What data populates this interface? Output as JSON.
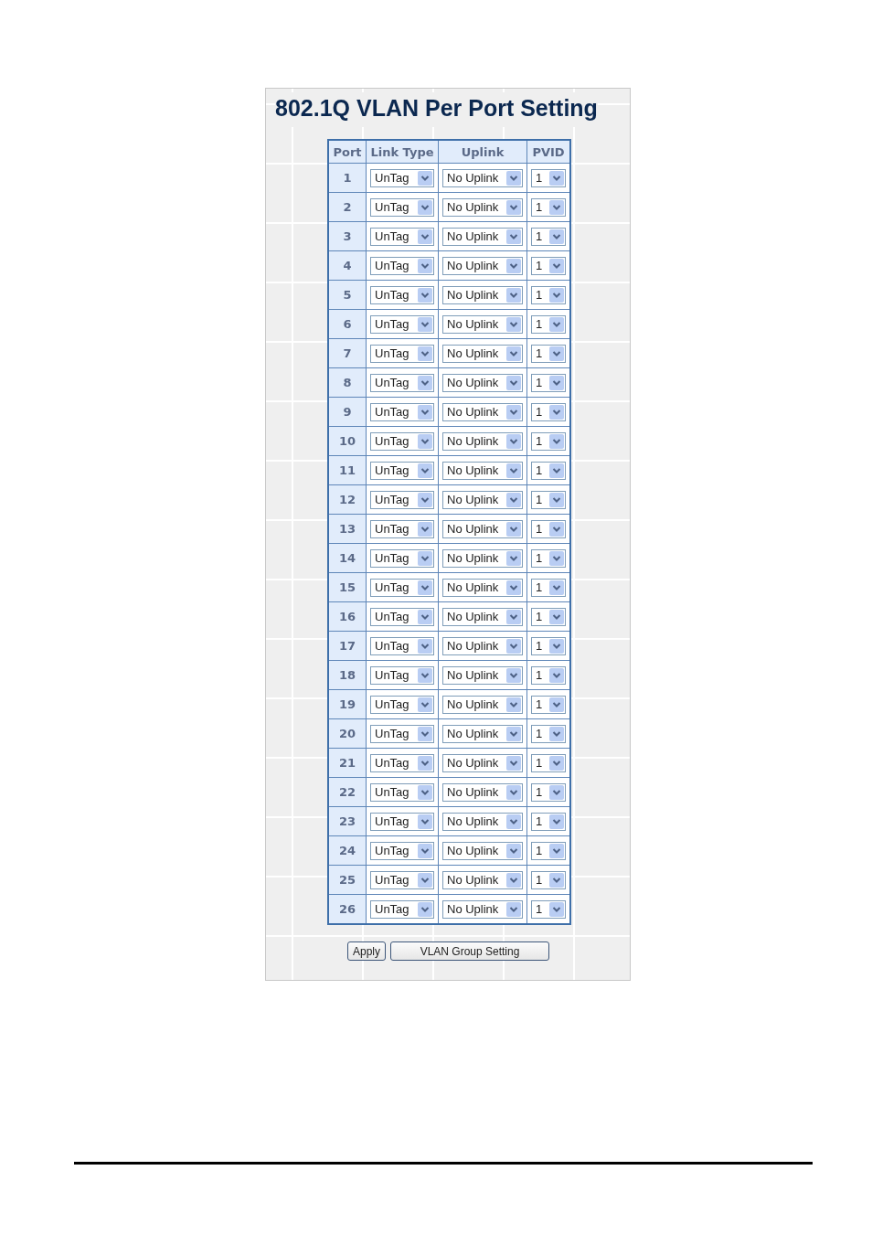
{
  "title": "802.1Q VLAN Per Port Setting",
  "table": {
    "columns": [
      "Port",
      "Link Type",
      "Uplink",
      "PVID"
    ],
    "rows": [
      {
        "port": "1",
        "link_type": "UnTag",
        "uplink": "No Uplink",
        "pvid": "1"
      },
      {
        "port": "2",
        "link_type": "UnTag",
        "uplink": "No Uplink",
        "pvid": "1"
      },
      {
        "port": "3",
        "link_type": "UnTag",
        "uplink": "No Uplink",
        "pvid": "1"
      },
      {
        "port": "4",
        "link_type": "UnTag",
        "uplink": "No Uplink",
        "pvid": "1"
      },
      {
        "port": "5",
        "link_type": "UnTag",
        "uplink": "No Uplink",
        "pvid": "1"
      },
      {
        "port": "6",
        "link_type": "UnTag",
        "uplink": "No Uplink",
        "pvid": "1"
      },
      {
        "port": "7",
        "link_type": "UnTag",
        "uplink": "No Uplink",
        "pvid": "1"
      },
      {
        "port": "8",
        "link_type": "UnTag",
        "uplink": "No Uplink",
        "pvid": "1"
      },
      {
        "port": "9",
        "link_type": "UnTag",
        "uplink": "No Uplink",
        "pvid": "1"
      },
      {
        "port": "10",
        "link_type": "UnTag",
        "uplink": "No Uplink",
        "pvid": "1"
      },
      {
        "port": "11",
        "link_type": "UnTag",
        "uplink": "No Uplink",
        "pvid": "1"
      },
      {
        "port": "12",
        "link_type": "UnTag",
        "uplink": "No Uplink",
        "pvid": "1"
      },
      {
        "port": "13",
        "link_type": "UnTag",
        "uplink": "No Uplink",
        "pvid": "1"
      },
      {
        "port": "14",
        "link_type": "UnTag",
        "uplink": "No Uplink",
        "pvid": "1"
      },
      {
        "port": "15",
        "link_type": "UnTag",
        "uplink": "No Uplink",
        "pvid": "1"
      },
      {
        "port": "16",
        "link_type": "UnTag",
        "uplink": "No Uplink",
        "pvid": "1"
      },
      {
        "port": "17",
        "link_type": "UnTag",
        "uplink": "No Uplink",
        "pvid": "1"
      },
      {
        "port": "18",
        "link_type": "UnTag",
        "uplink": "No Uplink",
        "pvid": "1"
      },
      {
        "port": "19",
        "link_type": "UnTag",
        "uplink": "No Uplink",
        "pvid": "1"
      },
      {
        "port": "20",
        "link_type": "UnTag",
        "uplink": "No Uplink",
        "pvid": "1"
      },
      {
        "port": "21",
        "link_type": "UnTag",
        "uplink": "No Uplink",
        "pvid": "1"
      },
      {
        "port": "22",
        "link_type": "UnTag",
        "uplink": "No Uplink",
        "pvid": "1"
      },
      {
        "port": "23",
        "link_type": "UnTag",
        "uplink": "No Uplink",
        "pvid": "1"
      },
      {
        "port": "24",
        "link_type": "UnTag",
        "uplink": "No Uplink",
        "pvid": "1"
      },
      {
        "port": "25",
        "link_type": "UnTag",
        "uplink": "No Uplink",
        "pvid": "1"
      },
      {
        "port": "26",
        "link_type": "UnTag",
        "uplink": "No Uplink",
        "pvid": "1"
      }
    ]
  },
  "buttons": [
    "Apply",
    "VLAN Group Setting"
  ]
}
